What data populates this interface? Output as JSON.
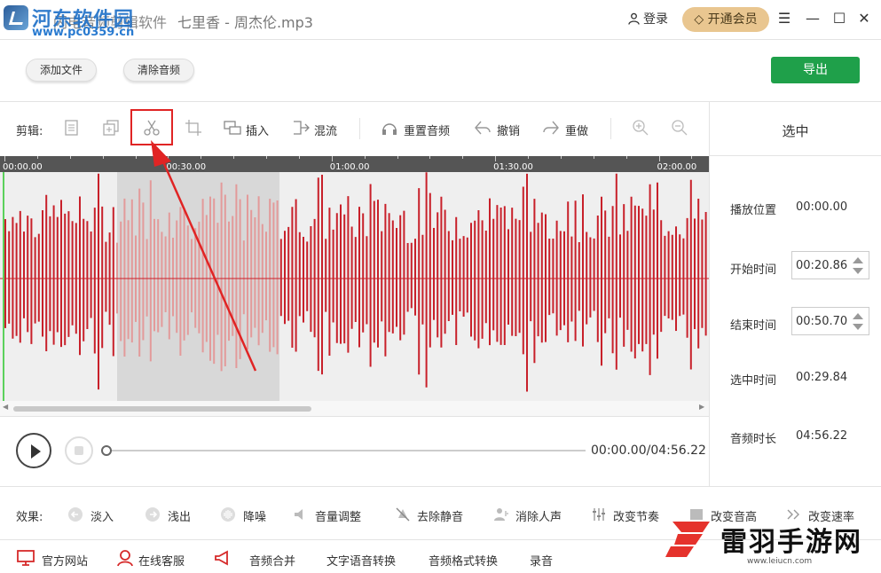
{
  "titlebar": {
    "app_title": "闪电音频剪辑软件",
    "file_name": "七里香 - 周杰伦.mp3",
    "login_label": "登录",
    "vip_label": "开通会员"
  },
  "watermark": {
    "site_name": "河东软件园",
    "site_url": "www.pc0359.cn",
    "corner_brand": "雷羽手游网",
    "corner_url": "www.leiucn.com"
  },
  "actions": {
    "add_file": "添加文件",
    "clear_audio": "清除音频",
    "export": "导出"
  },
  "toolbar": {
    "edit_label": "剪辑:",
    "insert": "插入",
    "mix": "混流",
    "reset_audio": "重置音频",
    "undo": "撤销",
    "redo": "重做"
  },
  "timeline": {
    "ticks": [
      "00:00.00",
      "00:30.00",
      "01:00.00",
      "01:30.00",
      "02:00.00"
    ],
    "wave_color": "#c8202a",
    "selected_wave_color": "#e39a9a",
    "selection_start": 20.86,
    "selection_end": 50.7,
    "seconds_per_screen": 130
  },
  "playback": {
    "time_display": "00:00.00/04:56.22",
    "progress": 0
  },
  "panel": {
    "title": "选中",
    "play_position_label": "播放位置",
    "play_position_value": "00:00.00",
    "start_time_label": "开始时间",
    "start_time_value": "00:20.86",
    "end_time_label": "结束时间",
    "end_time_value": "00:50.70",
    "selected_time_label": "选中时间",
    "selected_time_value": "00:29.84",
    "duration_label": "音频时长",
    "duration_value": "04:56.22"
  },
  "effects": {
    "label": "效果:",
    "items": [
      "淡入",
      "浅出",
      "降噪",
      "音量调整",
      "去除静音",
      "消除人声",
      "改变节奏",
      "改变音高",
      "改变速率"
    ]
  },
  "bottom_links": {
    "official_site": "官方网站",
    "online_service": "在线客服",
    "audio_merge": "音频合并",
    "text_to_speech": "文字语音转换",
    "format_convert": "音频格式转换",
    "record": "录音"
  },
  "colors": {
    "accent_green": "#1fa04a",
    "vip_gold": "#e9c690",
    "highlight_red": "#e02424"
  }
}
